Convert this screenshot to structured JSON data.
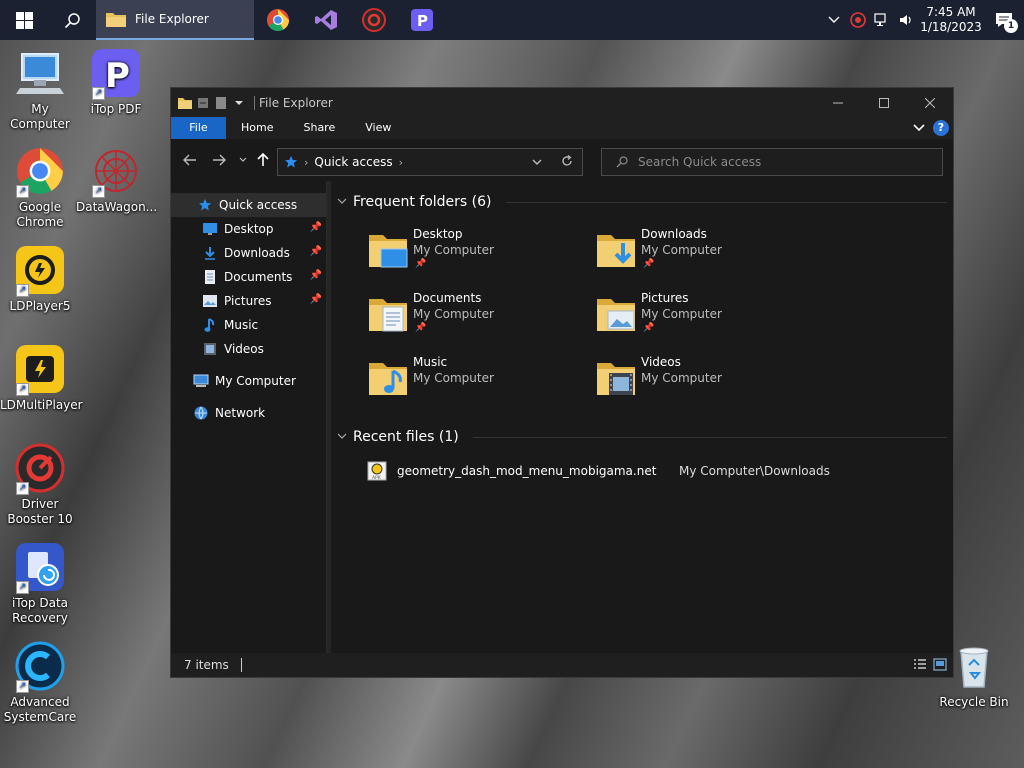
{
  "taskbar": {
    "explorer_task_label": "File Explorer",
    "clock_time": "7:45 AM",
    "clock_date": "1/18/2023",
    "notification_count": "1"
  },
  "desktop": {
    "icons": [
      {
        "label": "My Computer"
      },
      {
        "label": "iTop PDF"
      },
      {
        "label": "Google Chrome"
      },
      {
        "label": "DataWagon..."
      },
      {
        "label": "LDPlayer5"
      },
      {
        "label": "LDMultiPlayer"
      },
      {
        "label": "Driver Booster 10"
      },
      {
        "label": "iTop Data Recovery"
      },
      {
        "label": "Advanced SystemCare"
      },
      {
        "label": "Recycle Bin"
      }
    ]
  },
  "window": {
    "title": "File Explorer",
    "ribbon_tabs": {
      "file": "File",
      "home": "Home",
      "share": "Share",
      "view": "View"
    },
    "address": {
      "location": "Quick access"
    },
    "search": {
      "placeholder": "Search Quick access"
    },
    "nav": {
      "quick_access": "Quick access",
      "items": [
        {
          "label": "Desktop"
        },
        {
          "label": "Downloads"
        },
        {
          "label": "Documents"
        },
        {
          "label": "Pictures"
        },
        {
          "label": "Music"
        },
        {
          "label": "Videos"
        }
      ],
      "my_computer": "My Computer",
      "network": "Network"
    },
    "frequent": {
      "heading": "Frequent folders (6)",
      "folders": [
        {
          "name": "Desktop",
          "location": "My Computer"
        },
        {
          "name": "Downloads",
          "location": "My Computer"
        },
        {
          "name": "Documents",
          "location": "My Computer"
        },
        {
          "name": "Pictures",
          "location": "My Computer"
        },
        {
          "name": "Music",
          "location": "My Computer"
        },
        {
          "name": "Videos",
          "location": "My Computer"
        }
      ]
    },
    "recent": {
      "heading": "Recent files (1)",
      "files": [
        {
          "name": "geometry_dash_mod_menu_mobigama.net",
          "path": "My Computer\\Downloads",
          "icon_text": "APK"
        }
      ]
    },
    "status": {
      "items_count": "7 items"
    }
  },
  "colors": {
    "accent": "#1a66c6",
    "folder": "#e8c15a",
    "taskbar": "#1b2130"
  }
}
